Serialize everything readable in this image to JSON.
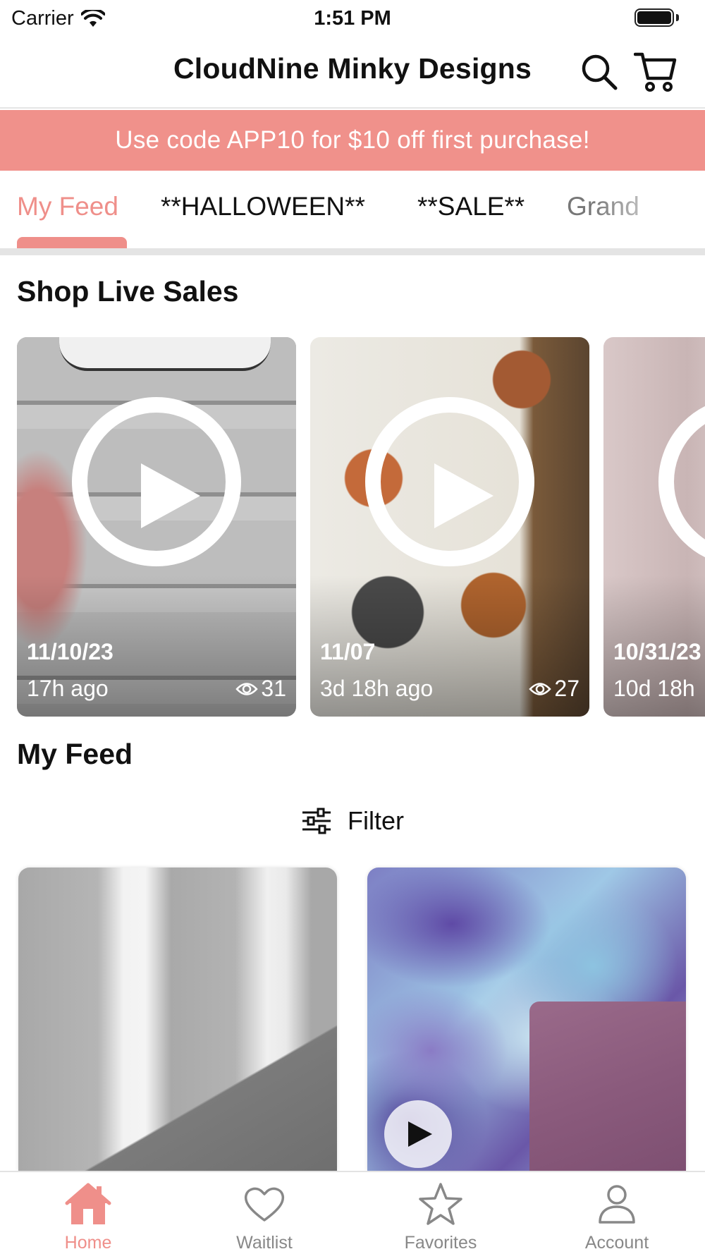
{
  "status_bar": {
    "carrier": "Carrier",
    "time": "1:51 PM"
  },
  "header": {
    "title": "CloudNine Minky Designs",
    "icons": [
      "search-icon",
      "cart-icon"
    ]
  },
  "promo": {
    "text": "Use code APP10 for $10 off first purchase!",
    "color": "#f0918b"
  },
  "tabs": [
    {
      "label": "My Feed",
      "active": true
    },
    {
      "label": "**HALLOWEEN**",
      "active": false
    },
    {
      "label": "**SALE**",
      "active": false
    },
    {
      "label": "Grand",
      "active": false
    }
  ],
  "live_sales": {
    "title": "Shop Live Sales",
    "cards": [
      {
        "date": "11/10/23",
        "ago": "17h ago",
        "views": "31"
      },
      {
        "date": "11/07",
        "ago": "3d 18h ago",
        "views": "27"
      },
      {
        "date": "10/31/23",
        "ago": "10d 18h",
        "views": ""
      }
    ]
  },
  "feed": {
    "title": "My Feed",
    "filter_label": "Filter"
  },
  "bottom_nav": [
    {
      "label": "Home",
      "icon": "home-icon",
      "active": true
    },
    {
      "label": "Waitlist",
      "icon": "heart-icon",
      "active": false
    },
    {
      "label": "Favorites",
      "icon": "star-icon",
      "active": false
    },
    {
      "label": "Account",
      "icon": "person-icon",
      "active": false
    }
  ],
  "colors": {
    "accent": "#ef8f8a",
    "text": "#111111",
    "inactive": "#888888"
  }
}
